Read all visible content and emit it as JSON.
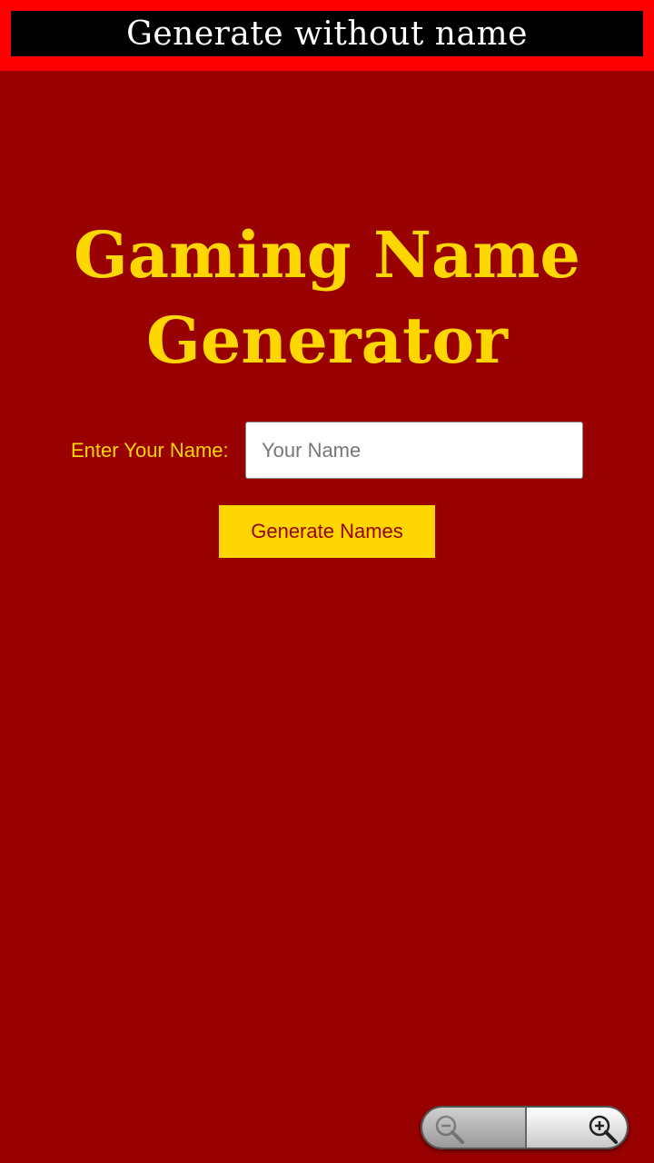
{
  "top_button": {
    "label": "Generate without name"
  },
  "title": "Gaming Name Generator",
  "form": {
    "label": "Enter Your Name:",
    "input_value": "",
    "input_placeholder": "Your Name",
    "submit_label": "Generate Names"
  },
  "zoom": {
    "out_icon": "zoom-out-icon",
    "in_icon": "zoom-in-icon"
  },
  "colors": {
    "background": "#990000",
    "accent": "#ffd700",
    "top_border": "#ff0000",
    "top_fill": "#000000"
  }
}
